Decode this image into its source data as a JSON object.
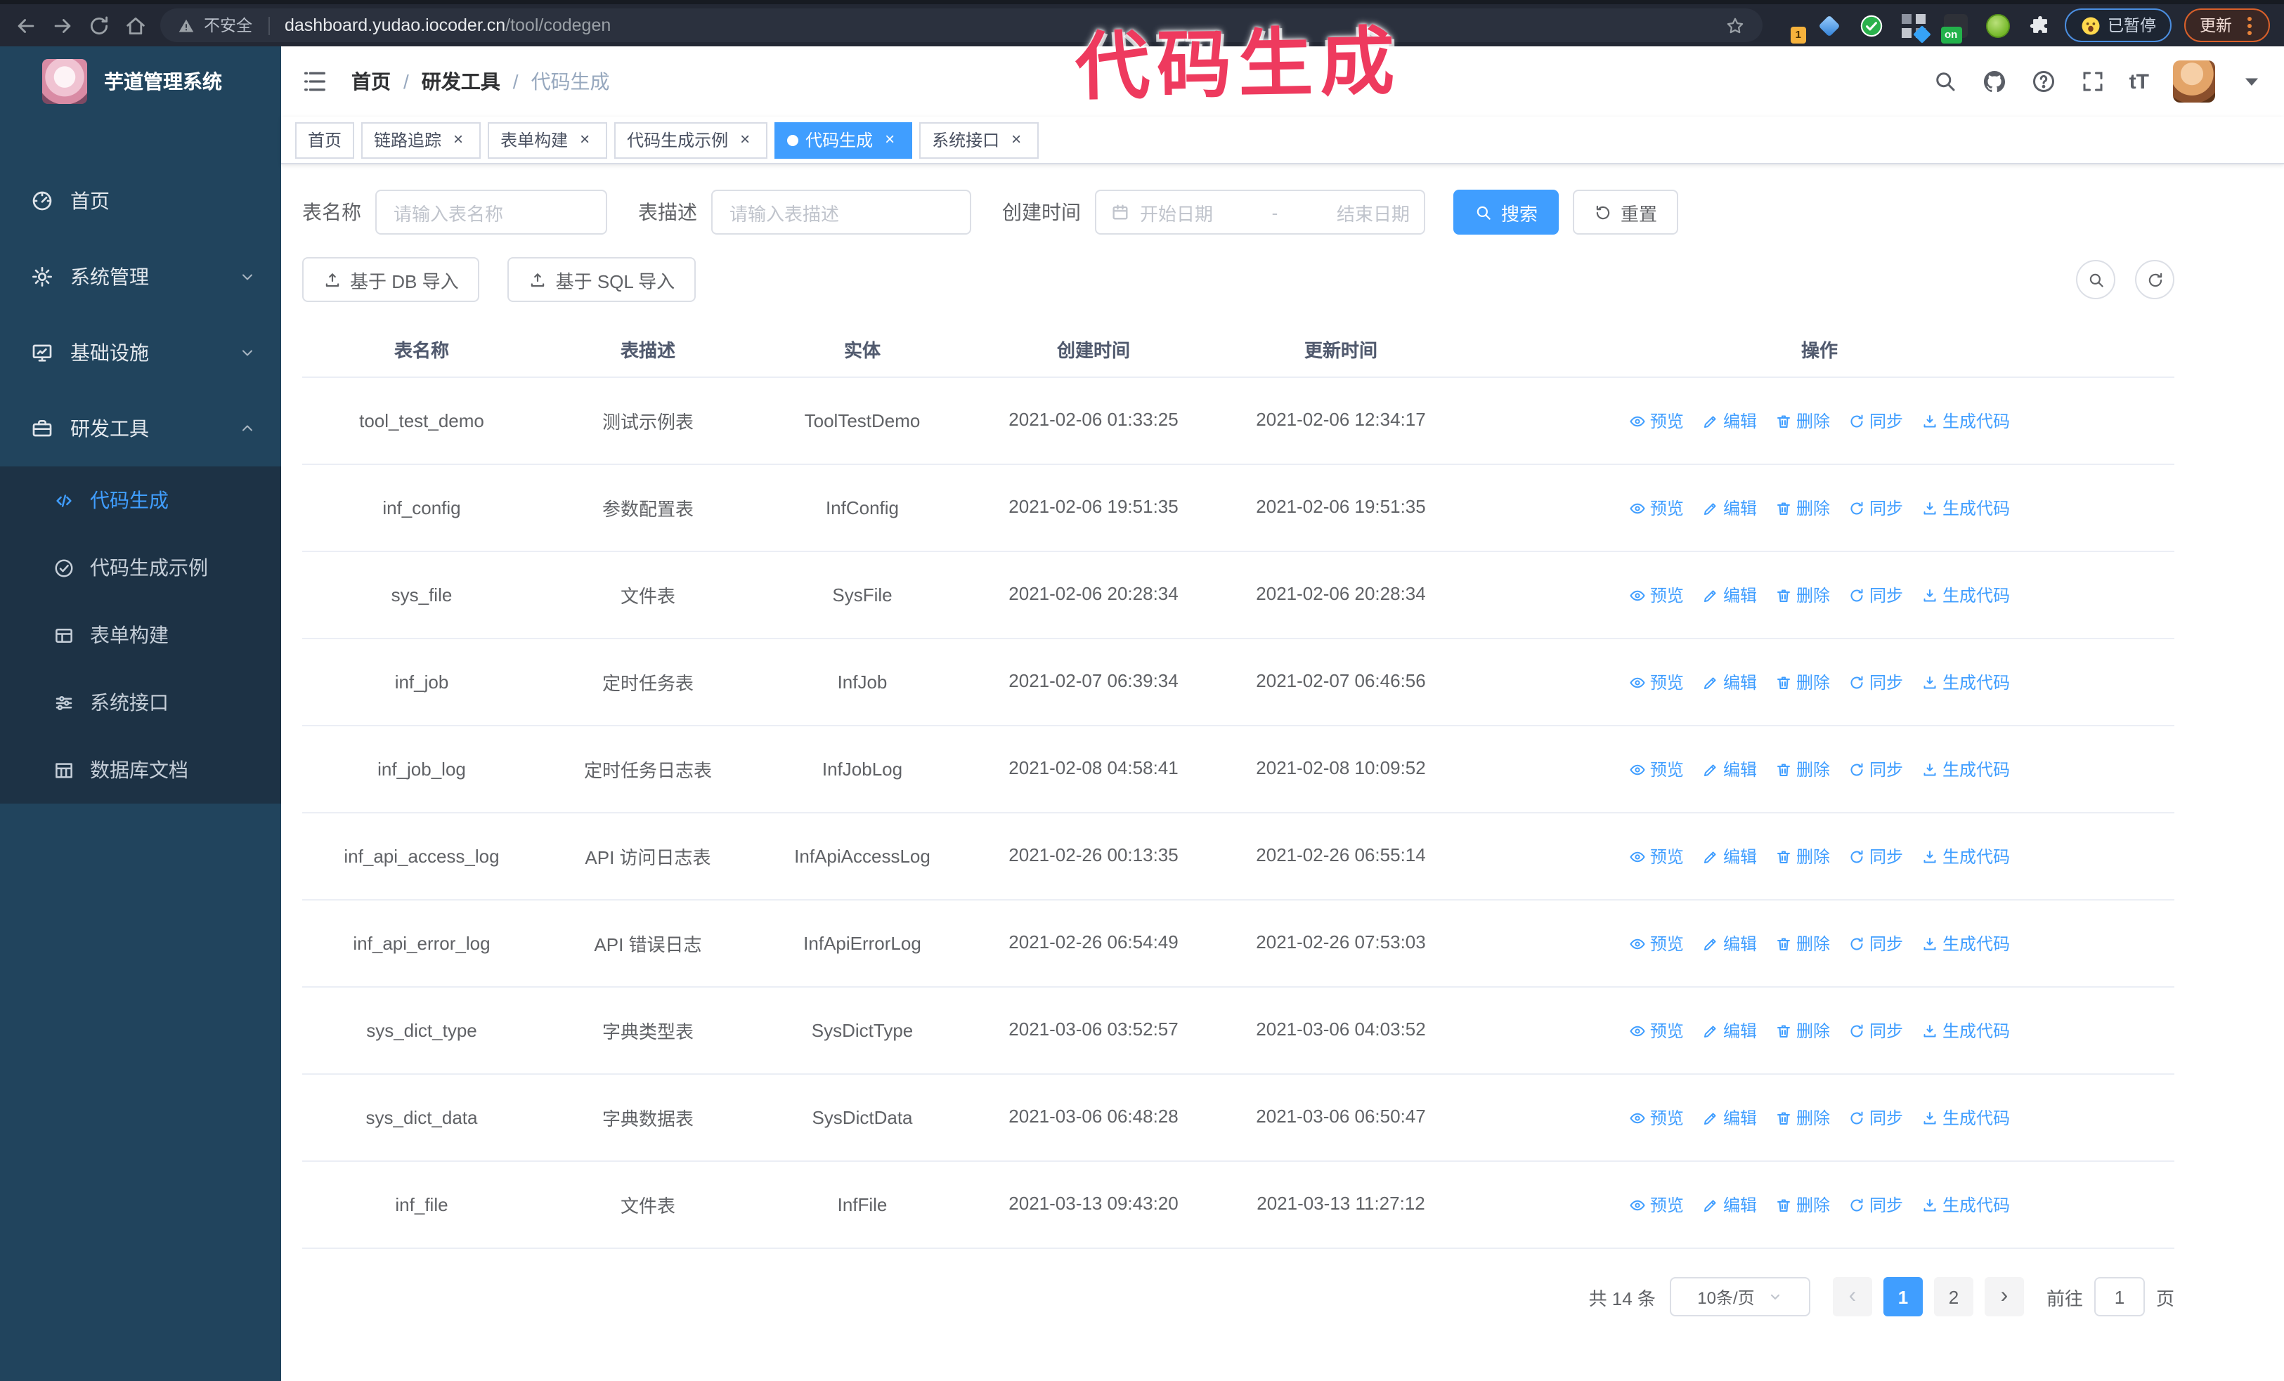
{
  "browser": {
    "security_label": "不安全",
    "url_domain": "dashboard.yudao.iocoder.cn",
    "url_path": "/tool/codegen",
    "extension_badge": "1",
    "extension_on_badge": "on",
    "paused_label": "已暂停",
    "update_label": "更新"
  },
  "annotation": {
    "text": "代码生成",
    "color": "#ee3a5e"
  },
  "sidebar": {
    "title": "芋道管理系统",
    "menu": [
      {
        "key": "home",
        "label": "首页",
        "icon": "dashboard-icon",
        "chevron": ""
      },
      {
        "key": "system-management",
        "label": "系统管理",
        "icon": "gear-icon",
        "chevron": "down"
      },
      {
        "key": "infrastructure",
        "label": "基础设施",
        "icon": "monitor-icon",
        "chevron": "down"
      },
      {
        "key": "dev-tools",
        "label": "研发工具",
        "icon": "toolbox-icon",
        "chevron": "up"
      }
    ],
    "submenu": [
      {
        "key": "codegen",
        "label": "代码生成",
        "icon": "code-icon",
        "active": true
      },
      {
        "key": "codegen-example",
        "label": "代码生成示例",
        "icon": "check-badge-icon",
        "active": false
      },
      {
        "key": "form-builder",
        "label": "表单构建",
        "icon": "form-icon",
        "active": false
      },
      {
        "key": "system-api",
        "label": "系统接口",
        "icon": "sliders-icon",
        "active": false
      },
      {
        "key": "db-doc",
        "label": "数据库文档",
        "icon": "dbdoc-icon",
        "active": false
      }
    ]
  },
  "header": {
    "breadcrumb": [
      "首页",
      "研发工具",
      "代码生成"
    ],
    "separator": "/"
  },
  "tabs": [
    {
      "key": "home",
      "label": "首页",
      "closable": false,
      "active": false
    },
    {
      "key": "trace",
      "label": "链路追踪",
      "closable": true,
      "active": false
    },
    {
      "key": "form-builder",
      "label": "表单构建",
      "closable": true,
      "active": false
    },
    {
      "key": "codegen-example",
      "label": "代码生成示例",
      "closable": true,
      "active": false
    },
    {
      "key": "codegen",
      "label": "代码生成",
      "closable": true,
      "active": true
    },
    {
      "key": "system-api",
      "label": "系统接口",
      "closable": true,
      "active": false
    }
  ],
  "filters": {
    "name_label": "表名称",
    "name_placeholder": "请输入表名称",
    "desc_label": "表描述",
    "desc_placeholder": "请输入表描述",
    "time_label": "创建时间",
    "start_placeholder": "开始日期",
    "range_separator": "-",
    "end_placeholder": "结束日期",
    "search_label": "搜索",
    "reset_label": "重置"
  },
  "toolbar": {
    "db_import_label": "基于 DB 导入",
    "sql_import_label": "基于 SQL 导入"
  },
  "table": {
    "columns": [
      "表名称",
      "表描述",
      "实体",
      "创建时间",
      "更新时间",
      "操作"
    ],
    "actions": [
      {
        "key": "preview",
        "label": "预览",
        "icon": "eye-icon"
      },
      {
        "key": "edit",
        "label": "编辑",
        "icon": "edit-icon"
      },
      {
        "key": "delete",
        "label": "删除",
        "icon": "delete-icon"
      },
      {
        "key": "sync",
        "label": "同步",
        "icon": "sync-icon"
      },
      {
        "key": "generate-code",
        "label": "生成代码",
        "icon": "download-icon"
      }
    ],
    "rows": [
      {
        "name": "tool_test_demo",
        "desc": "测试示例表",
        "entity": "ToolTestDemo",
        "created": "2021-02-06 01:33:25",
        "updated": "2021-02-06 12:34:17"
      },
      {
        "name": "inf_config",
        "desc": "参数配置表",
        "entity": "InfConfig",
        "created": "2021-02-06 19:51:35",
        "updated": "2021-02-06 19:51:35"
      },
      {
        "name": "sys_file",
        "desc": "文件表",
        "entity": "SysFile",
        "created": "2021-02-06 20:28:34",
        "updated": "2021-02-06 20:28:34"
      },
      {
        "name": "inf_job",
        "desc": "定时任务表",
        "entity": "InfJob",
        "created": "2021-02-07 06:39:34",
        "updated": "2021-02-07 06:46:56"
      },
      {
        "name": "inf_job_log",
        "desc": "定时任务日志表",
        "entity": "InfJobLog",
        "created": "2021-02-08 04:58:41",
        "updated": "2021-02-08 10:09:52"
      },
      {
        "name": "inf_api_access_log",
        "desc": "API 访问日志表",
        "entity": "InfApiAccessLog",
        "created": "2021-02-26 00:13:35",
        "updated": "2021-02-26 06:55:14"
      },
      {
        "name": "inf_api_error_log",
        "desc": "API 错误日志",
        "entity": "InfApiErrorLog",
        "created": "2021-02-26 06:54:49",
        "updated": "2021-02-26 07:53:03"
      },
      {
        "name": "sys_dict_type",
        "desc": "字典类型表",
        "entity": "SysDictType",
        "created": "2021-03-06 03:52:57",
        "updated": "2021-03-06 04:03:52"
      },
      {
        "name": "sys_dict_data",
        "desc": "字典数据表",
        "entity": "SysDictData",
        "created": "2021-03-06 06:48:28",
        "updated": "2021-03-06 06:50:47"
      },
      {
        "name": "inf_file",
        "desc": "文件表",
        "entity": "InfFile",
        "created": "2021-03-13 09:43:20",
        "updated": "2021-03-13 11:27:12"
      }
    ]
  },
  "pagination": {
    "total_label": "共 14 条",
    "page_size_label": "10条/页",
    "pages": [
      "1",
      "2"
    ],
    "active_page": "1",
    "goto_label": "前往",
    "goto_value": "1",
    "page_unit_label": "页"
  },
  "colors": {
    "accent": "#409EFF",
    "sidebar_bg": "#21445d",
    "submenu_bg": "#1d3245",
    "annotation": "#ee3a5e",
    "browser_bar": "#232834"
  }
}
